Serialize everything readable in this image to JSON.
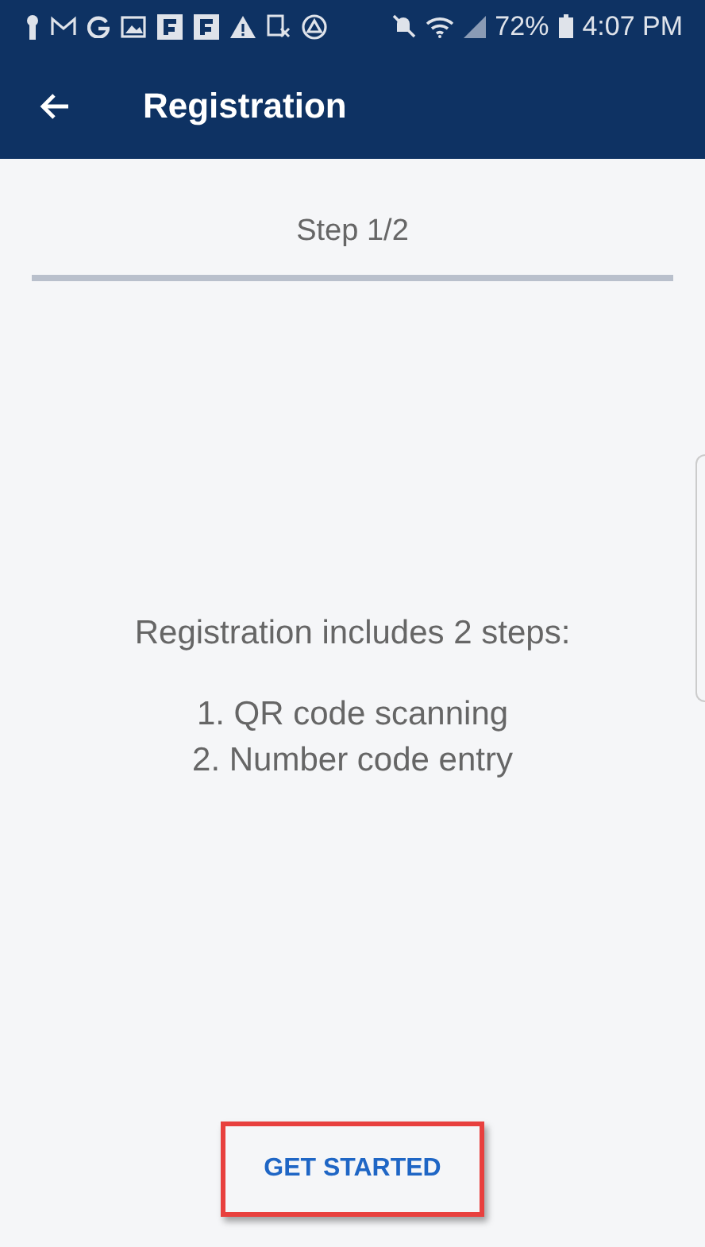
{
  "status_bar": {
    "battery": "72%",
    "time": "4:07 PM"
  },
  "app_bar": {
    "title": "Registration"
  },
  "step": {
    "label": "Step 1/2"
  },
  "intro": {
    "heading": "Registration includes 2 steps:",
    "steps": [
      "1. QR code scanning",
      "2. Number code entry"
    ]
  },
  "button": {
    "label": "GET STARTED",
    "highlighted": true
  }
}
